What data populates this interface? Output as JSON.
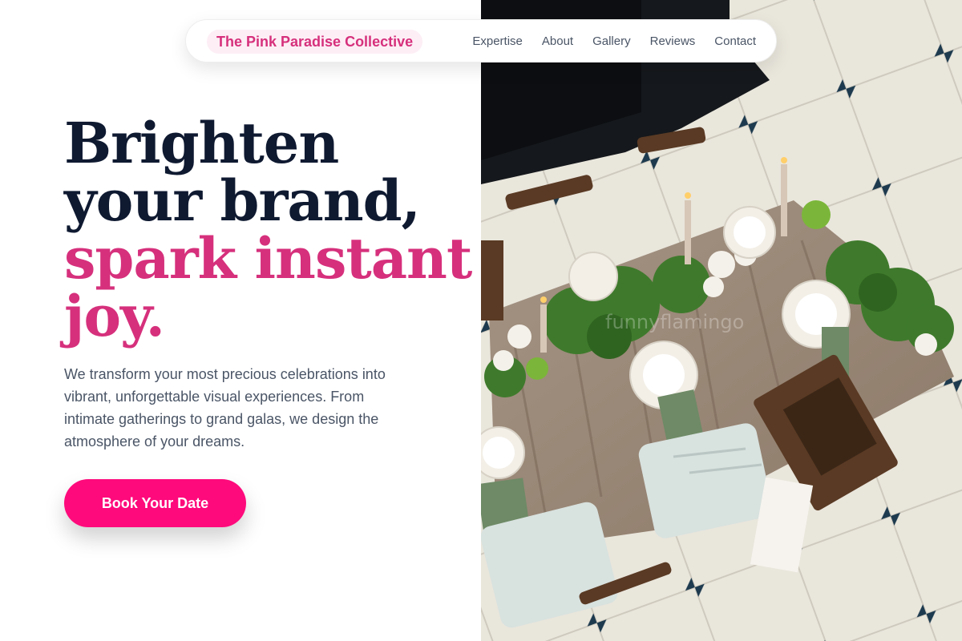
{
  "nav": {
    "brand": "The Pink Paradise Collective",
    "links": [
      "Expertise",
      "About",
      "Gallery",
      "Reviews",
      "Contact"
    ]
  },
  "hero": {
    "title_lines": [
      "Brighten",
      "your brand,"
    ],
    "accent_lines": [
      "spark instant",
      "joy."
    ],
    "description": "We transform your most precious celebrations into vibrant, unforgettable visual experiences. From intimate gatherings to grand galas, we design the atmosphere of your dreams.",
    "cta_label": "Book Your Date"
  },
  "photo": {
    "watermark": "funnyflamingo"
  },
  "colors": {
    "accent": "#d6307c",
    "cta": "#fe0a7c",
    "heading": "#0f1a31",
    "body_text": "#4a5566"
  }
}
